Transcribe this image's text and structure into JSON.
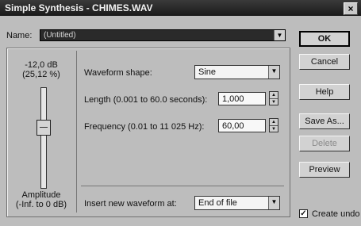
{
  "window": {
    "title": "Simple Synthesis - CHIMES.WAV",
    "close_glyph": "×"
  },
  "name": {
    "label": "Name:",
    "value": "(Untitled)"
  },
  "amplitude": {
    "value_db": "-12,0 dB",
    "value_pct": "(25,12 %)",
    "label": "Amplitude",
    "range": "(-Inf. to 0 dB)",
    "level_fraction": 0.62
  },
  "waveform": {
    "label": "Waveform shape:",
    "value": "Sine"
  },
  "length": {
    "label": "Length (0.001 to 60.0 seconds):",
    "value": "1,000"
  },
  "frequency": {
    "label": "Frequency (0.01 to 11 025 Hz):",
    "value": "60,00"
  },
  "insert": {
    "label": "Insert new waveform at:",
    "value": "End of file"
  },
  "buttons": {
    "ok": "OK",
    "cancel": "Cancel",
    "help": "Help",
    "save_as": "Save As...",
    "delete": "Delete",
    "preview": "Preview"
  },
  "create_undo": {
    "label": "Create undo",
    "checked": true,
    "check_glyph": "✓"
  },
  "dropdown_glyph": "▼",
  "spin_up": "▲",
  "spin_down": "▼"
}
